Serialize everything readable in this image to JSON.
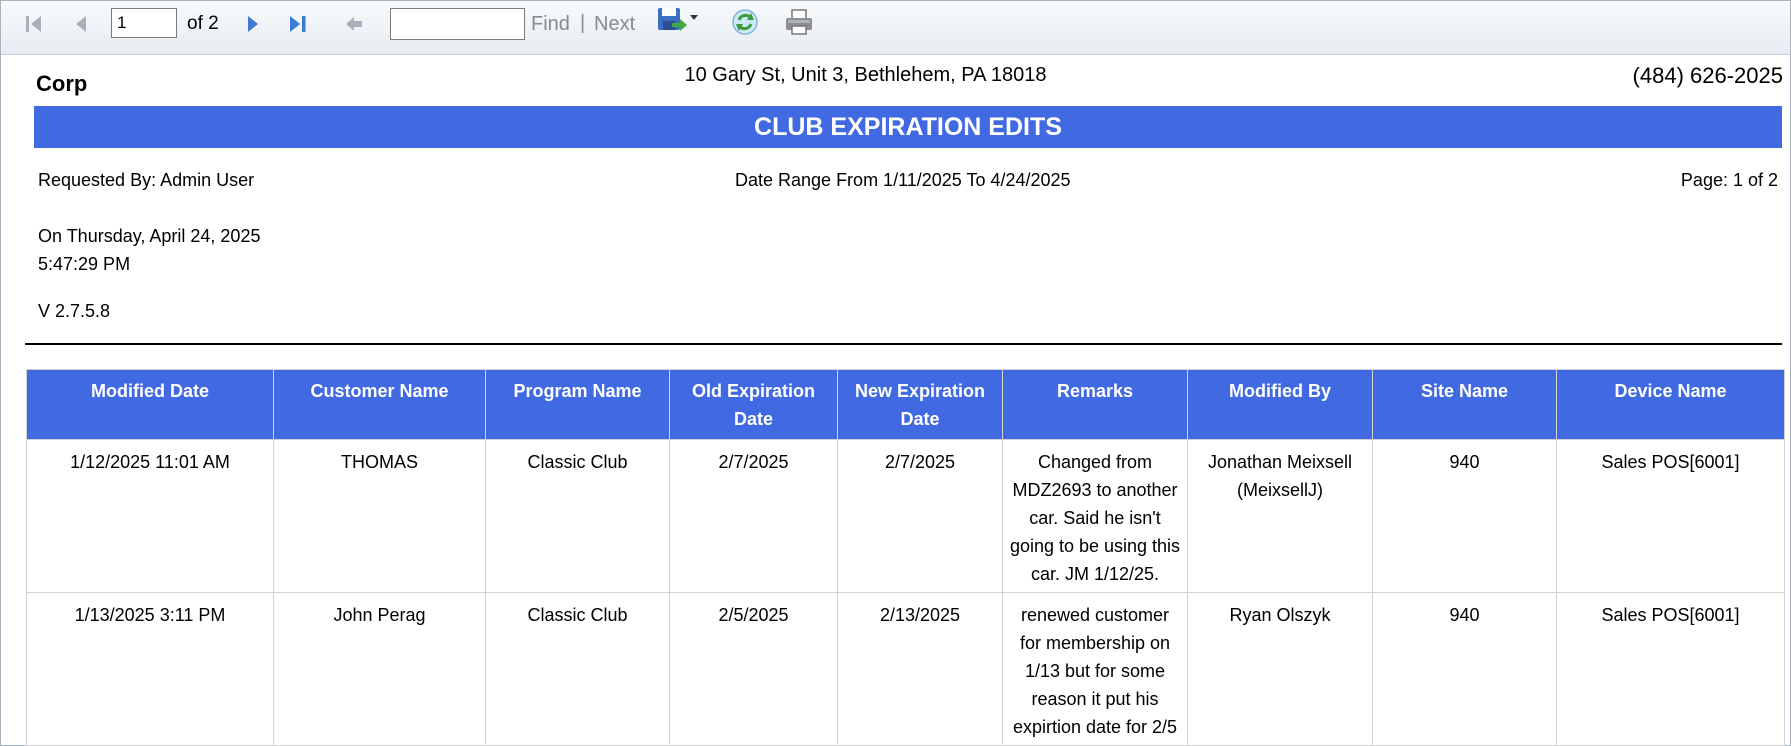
{
  "toolbar": {
    "page_value": "1",
    "of_pages": "of 2",
    "find_value": "",
    "find_label": "Find",
    "separator": "|",
    "next_label": "Next"
  },
  "report": {
    "company": "Corp",
    "address": "10 Gary St, Unit 3, Bethlehem, PA 18018",
    "phone": "(484) 626-2025",
    "title": "CLUB EXPIRATION EDITS",
    "requested_by": "Requested By: Admin User",
    "date_range": "Date Range From 1/11/2025 To 4/24/2025",
    "page": "Page: 1 of 2",
    "run_date": "On Thursday, April 24, 2025",
    "run_time": "5:47:29 PM",
    "version": "V 2.7.5.8",
    "title_color": "#4169e1"
  },
  "table": {
    "headers": [
      "Modified Date",
      "Customer Name",
      "Program Name",
      "Old Expiration Date",
      "New Expiration Date",
      "Remarks",
      "Modified By",
      "Site Name",
      "Device Name"
    ],
    "rows": [
      [
        "1/12/2025 11:01 AM",
        "THOMAS",
        "Classic Club",
        "2/7/2025",
        "2/7/2025",
        "Changed from MDZ2693 to another car. Said he isn't going to be using this car. JM 1/12/25.",
        "Jonathan Meixsell (MeixsellJ)",
        "940",
        "Sales POS[6001]"
      ],
      [
        "1/13/2025 3:11 PM",
        "John Perag",
        "Classic Club",
        "2/5/2025",
        "2/13/2025",
        "renewed customer for membership on 1/13 but for some reason it put his expirtion date for 2/5",
        "Ryan Olszyk",
        "940",
        "Sales POS[6001]"
      ]
    ]
  },
  "icons": [
    "first-page-icon",
    "previous-page-icon",
    "next-page-icon",
    "last-page-icon",
    "back-icon",
    "export-save-icon",
    "refresh-icon",
    "print-icon"
  ]
}
